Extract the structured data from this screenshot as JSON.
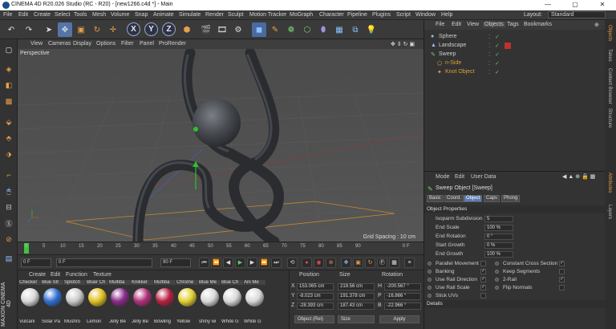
{
  "window": {
    "title": "CINEMA 4D R20.026 Studio (RC - R20) - [new1266.c4d *] - Main",
    "min": "—",
    "max": "▢",
    "close": "✕"
  },
  "menu": [
    "File",
    "Edit",
    "Create",
    "Select",
    "Tools",
    "Mesh",
    "Volume",
    "Snap",
    "Animate",
    "Simulate",
    "Render",
    "Sculpt",
    "Motion Tracker",
    "MoGraph",
    "Character",
    "Pipeline",
    "Plugins",
    "Script",
    "Window",
    "Help"
  ],
  "layout": {
    "label": "Layout:",
    "value": "Standard"
  },
  "viewport_menu": [
    "View",
    "Cameras",
    "Display",
    "Options",
    "Filter",
    "Panel",
    "ProRender"
  ],
  "viewport": {
    "label": "Perspective",
    "grid": "Grid Spacing : 10 cm"
  },
  "timeline": {
    "ticks": [
      "0",
      "5",
      "10",
      "15",
      "20",
      "25",
      "30",
      "35",
      "40",
      "45",
      "50",
      "55",
      "60",
      "65",
      "70",
      "75",
      "80",
      "85",
      "90"
    ],
    "end": "0 F"
  },
  "transport": {
    "start": "0 F",
    "current": "0 F",
    "end": "90 F",
    "end2": "90 F"
  },
  "materials": {
    "menu": [
      "Create",
      "Edit",
      "Function",
      "Texture"
    ],
    "items": [
      {
        "top": "Checker",
        "bottom": "Vulcani",
        "color": "#d8d8d8"
      },
      {
        "top": "Blue Str",
        "bottom": "Solar Pa",
        "color": "#2f6fd0"
      },
      {
        "top": "Splotch",
        "bottom": "Mushro",
        "color": "#c9c9c9"
      },
      {
        "top": "Bluer Ch",
        "bottom": "Lemon",
        "color": "#e0c020"
      },
      {
        "top": "Multiba",
        "bottom": "Jelly Be",
        "color": "#8a2a8a"
      },
      {
        "top": "Knikker",
        "bottom": "Jelly Be",
        "color": "#b0307a"
      },
      {
        "top": "Multiba",
        "bottom": "Bowling",
        "color": "#b82040"
      },
      {
        "top": "Chrome",
        "bottom": "Yellow",
        "color": "#e0d030"
      },
      {
        "top": "Blue Me",
        "bottom": "shiny wi",
        "color": "#d8d8d8"
      },
      {
        "top": "Blue Ch",
        "bottom": "White G",
        "color": "#d8d8d8"
      },
      {
        "top": "Ani Me",
        "bottom": "White G",
        "color": "#d8d8d8"
      }
    ]
  },
  "coords": {
    "headers": [
      "Position",
      "Size",
      "Rotation"
    ],
    "rows": [
      {
        "axis": "X",
        "pos": "153.065 cm",
        "size": "219.56 cm",
        "rl": "H",
        "rot": "-200.567 °"
      },
      {
        "axis": "Y",
        "pos": "-8.023 cm",
        "size": "191.378 cm",
        "rl": "P",
        "rot": "-16.866 °"
      },
      {
        "axis": "Z",
        "pos": "-28.393 cm",
        "size": "187.43 cm",
        "rl": "B",
        "rot": "-22.966 °"
      }
    ],
    "mode": "Object (Rel)",
    "size_mode": "Size",
    "apply": "Apply"
  },
  "objmgr": {
    "menu": [
      "File",
      "Edit",
      "View",
      "Objects",
      "Tags",
      "Bookmarks"
    ],
    "objects": [
      {
        "name": "Sphere",
        "color": "#cfcfcf"
      },
      {
        "name": "Landscape",
        "color": "#cfcfcf"
      },
      {
        "name": "Sweep",
        "color": "#cfcfcf"
      },
      {
        "name": "n-Side",
        "color": "#d9a23a"
      },
      {
        "name": "Knot Object",
        "color": "#d9a23a"
      }
    ]
  },
  "attr": {
    "menu": [
      "Mode",
      "Edit",
      "User Data"
    ],
    "object_title": "Sweep Object [Sweep]",
    "tabs": [
      "Basic",
      "Coord.",
      "Object",
      "Caps",
      "Phong"
    ],
    "active_tab": "Object",
    "section": "Object Properties",
    "props": [
      {
        "label": "Isoparm Subdivision",
        "value": "5"
      },
      {
        "label": "End Scale",
        "value": "100 %"
      },
      {
        "label": "End Rotation",
        "value": "0 °"
      },
      {
        "label": "Start Growth",
        "value": "0 %"
      },
      {
        "label": "End Growth",
        "value": "100 %"
      }
    ],
    "checks_left": [
      {
        "label": "Parallel Movement",
        "checked": ""
      },
      {
        "label": "Banking",
        "checked": "✓"
      },
      {
        "label": "Use Rail Direction",
        "checked": "✓"
      },
      {
        "label": "Use Rail Scale",
        "checked": "✓"
      },
      {
        "label": "Stick UVs",
        "checked": ""
      }
    ],
    "checks_right": [
      {
        "label": "Constant Cross Section",
        "checked": "✓"
      },
      {
        "label": "Keep Segments",
        "checked": ""
      },
      {
        "label": "2-Rail",
        "checked": "✓"
      },
      {
        "label": "Flip Normals",
        "checked": ""
      }
    ],
    "details": "Details"
  },
  "sidetabs": [
    "Objects",
    "Takes",
    "Content Browser",
    "Structure",
    "Attributes",
    "Layers"
  ]
}
